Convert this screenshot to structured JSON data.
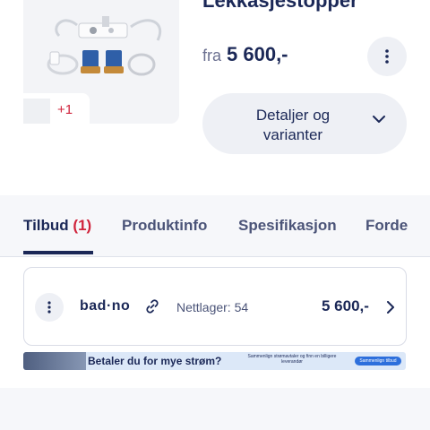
{
  "product": {
    "title": "Lekkasjestopper",
    "price_prefix": "fra",
    "price": "5 600,-",
    "more_thumbnails": "+1",
    "details_label": "Detaljer og varianter"
  },
  "tabs": [
    {
      "label": "Tilbud",
      "count": "(1)"
    },
    {
      "label": "Produktinfo"
    },
    {
      "label": "Spesifikasjon"
    },
    {
      "label": "Forde"
    }
  ],
  "offer": {
    "shop": "bad·no",
    "stock": "Nettlager: 54",
    "price": "5 600,-"
  },
  "banner": {
    "headline": "Betaler du for mye strøm?",
    "text": "Sammenlign strømavtaler og finn en billigere leverandør",
    "cta": "Sammenlign tilbud"
  },
  "colors": {
    "navy": "#1b2857",
    "accent_red": "#d0243c",
    "cta_blue": "#2d6fdc"
  }
}
